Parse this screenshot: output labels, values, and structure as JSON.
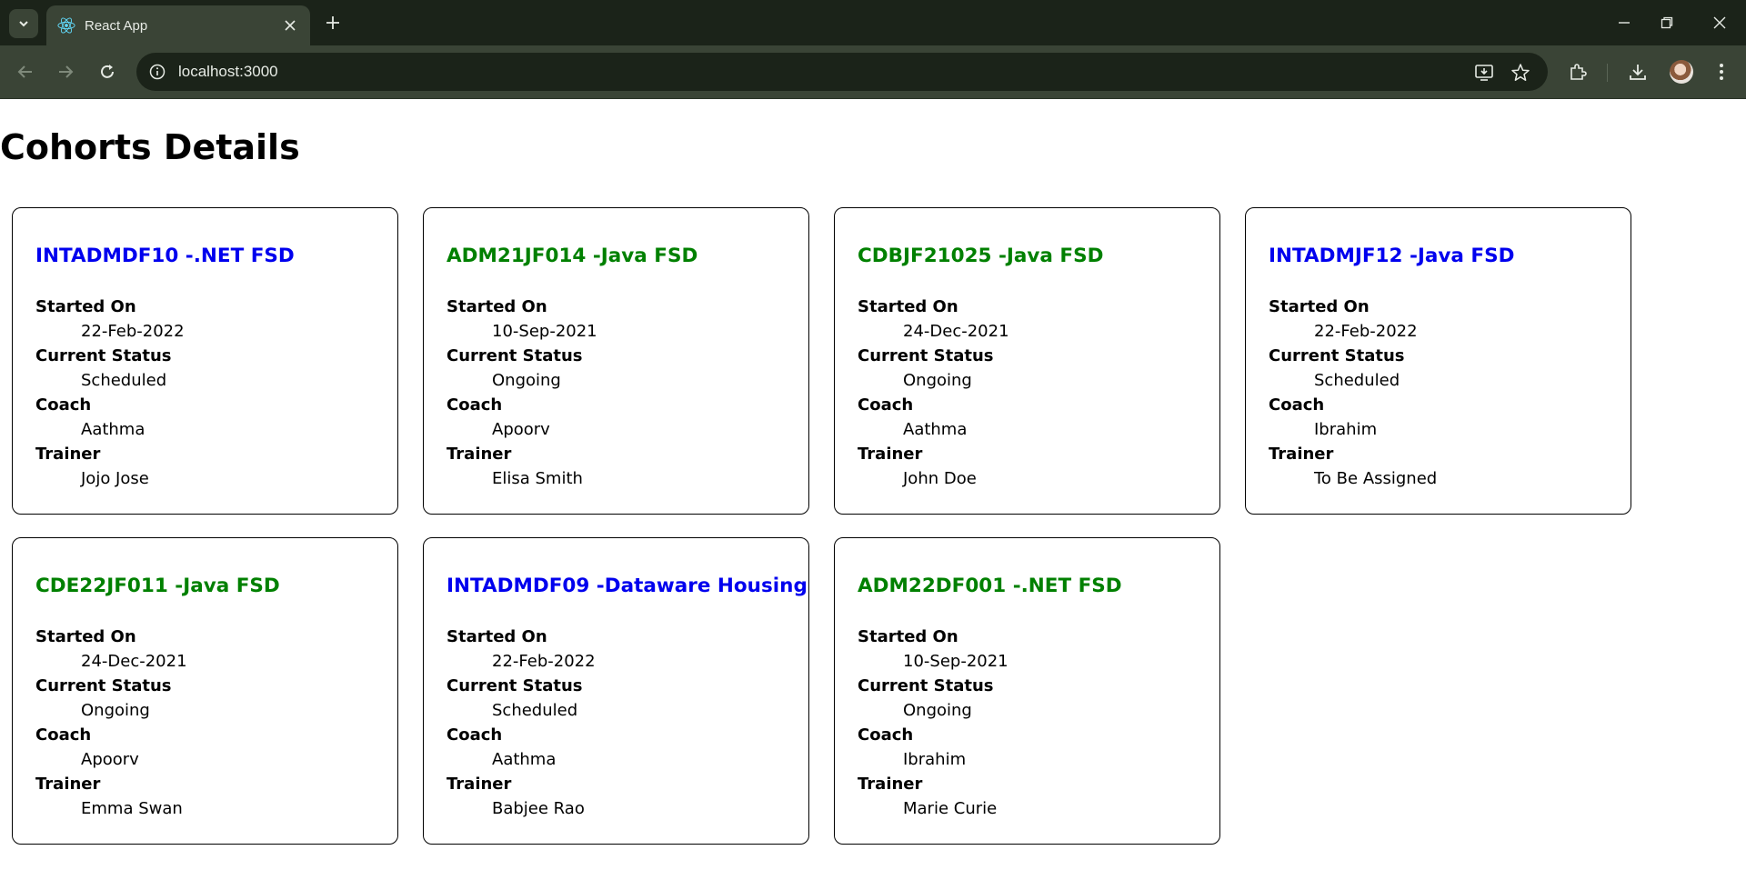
{
  "browser": {
    "tab_title": "React App",
    "url": "localhost:3000"
  },
  "page": {
    "title": "Cohorts Details"
  },
  "labels": {
    "started_on": "Started On",
    "current_status": "Current Status",
    "coach": "Coach",
    "trainer": "Trainer"
  },
  "colors": {
    "scheduled": "#0000ee",
    "ongoing": "#008000"
  },
  "cohorts": [
    {
      "code": "INTADMDF10 -.NET FSD",
      "started_on": "22-Feb-2022",
      "status": "Scheduled",
      "coach": "Aathma",
      "trainer": "Jojo Jose"
    },
    {
      "code": "ADM21JF014 -Java FSD",
      "started_on": "10-Sep-2021",
      "status": "Ongoing",
      "coach": "Apoorv",
      "trainer": "Elisa Smith"
    },
    {
      "code": "CDBJF21025 -Java FSD",
      "started_on": "24-Dec-2021",
      "status": "Ongoing",
      "coach": "Aathma",
      "trainer": "John Doe"
    },
    {
      "code": "INTADMJF12 -Java FSD",
      "started_on": "22-Feb-2022",
      "status": "Scheduled",
      "coach": "Ibrahim",
      "trainer": "To Be Assigned"
    },
    {
      "code": "CDE22JF011 -Java FSD",
      "started_on": "24-Dec-2021",
      "status": "Ongoing",
      "coach": "Apoorv",
      "trainer": "Emma Swan"
    },
    {
      "code": "INTADMDF09 -Dataware Housing",
      "started_on": "22-Feb-2022",
      "status": "Scheduled",
      "coach": "Aathma",
      "trainer": "Babjee Rao"
    },
    {
      "code": "ADM22DF001 -.NET FSD",
      "started_on": "10-Sep-2021",
      "status": "Ongoing",
      "coach": "Ibrahim",
      "trainer": "Marie Curie"
    }
  ]
}
